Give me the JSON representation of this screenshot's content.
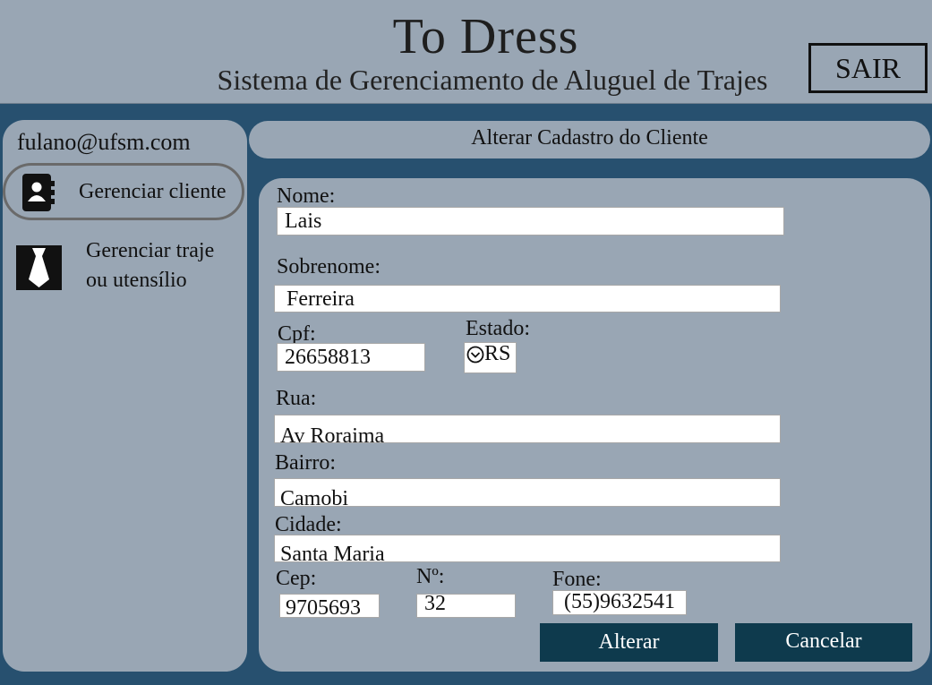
{
  "header": {
    "title": "To Dress",
    "subtitle": "Sistema de Gerenciamento de Aluguel de Trajes",
    "logout_label": "SAIR"
  },
  "sidebar": {
    "user_email": "fulano@ufsm.com",
    "items": [
      {
        "label": "Gerenciar cliente",
        "icon": "contacts-book-icon",
        "active": true
      },
      {
        "label_line1": "Gerenciar traje",
        "label_line2": "ou utensílio",
        "icon": "necktie-icon",
        "active": false
      }
    ]
  },
  "page_title": "Alterar Cadastro do Cliente",
  "form": {
    "nome": {
      "label": "Nome:",
      "value": "Lais"
    },
    "sobrenome": {
      "label": "Sobrenome:",
      "value": "Ferreira"
    },
    "cpf": {
      "label": "Cpf:",
      "value": "26658813"
    },
    "estado": {
      "label": "Estado:",
      "value": "RS"
    },
    "rua": {
      "label": "Rua:",
      "value": "Av Roraima"
    },
    "bairro": {
      "label": "Bairro:",
      "value": "Camobi"
    },
    "cidade": {
      "label": "Cidade:",
      "value": "Santa Maria"
    },
    "cep": {
      "label": "Cep:",
      "value": "9705693"
    },
    "numero": {
      "label": "Nº:",
      "value": "32"
    },
    "fone": {
      "label": "Fone:",
      "value": "(55)9632541"
    }
  },
  "actions": {
    "alterar": "Alterar",
    "cancelar": "Cancelar"
  },
  "colors": {
    "background": "#27506f",
    "panel": "#99a6b4",
    "button": "#0e3a4d"
  }
}
